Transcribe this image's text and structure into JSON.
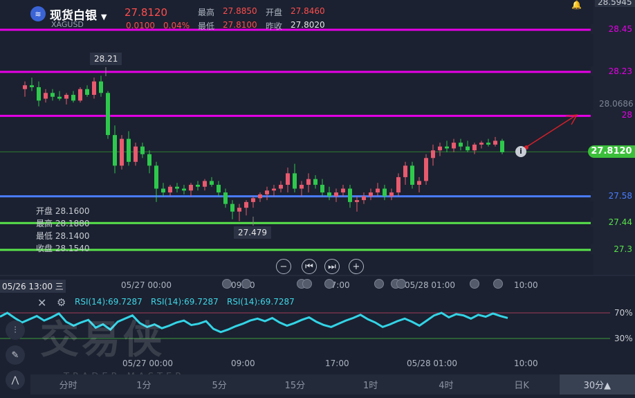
{
  "header": {
    "title": "现货白银",
    "symbol": "XAGUSD",
    "price": "27.8120",
    "change": "0.0100",
    "change_pct": "0.04%",
    "high_label": "最高",
    "high": "27.8850",
    "open_label": "开盘",
    "open": "27.8460",
    "low_label": "最低",
    "low": "27.8100",
    "prev_close_label": "昨收",
    "prev_close": "27.8020",
    "top_price": "28.5945",
    "bell_icon": "bell-icon"
  },
  "levels": [
    {
      "value": 28.45,
      "label": "28.45",
      "color": "#e600e6"
    },
    {
      "value": 28.23,
      "label": "28.23",
      "color": "#e600e6"
    },
    {
      "value": 28.0,
      "label": "28",
      "color": "#e600e6"
    },
    {
      "value": 27.58,
      "label": "27.58",
      "color": "#4a7dff"
    },
    {
      "value": 27.44,
      "label": "27.44",
      "color": "#59e34a"
    },
    {
      "value": 27.3,
      "label": "27.3",
      "color": "#59e34a"
    }
  ],
  "axis_labels": {
    "p1": "28.0686"
  },
  "current_price_tag": "27.8120",
  "annotations": {
    "high_marker": "28.21",
    "low_marker": "27.479"
  },
  "ohlc_box": {
    "open_label": "开盘",
    "open": "28.1600",
    "high_label": "最高",
    "high": "28.1880",
    "low_label": "最低",
    "low": "28.1400",
    "close_label": "收盘",
    "close": "28.1540"
  },
  "toolbar": {
    "zoom_out": "−",
    "prev": "⏮",
    "next": "⏭",
    "zoom_in": "+"
  },
  "time_axis": {
    "cursor_label": "05/26 13:00 三",
    "t1": "05/27 00:00",
    "t2": "09:00",
    "t3": "17:00",
    "t4": "05/28 01:00",
    "t5": "10:00"
  },
  "rsi": {
    "label1": "RSI(14):69.7287",
    "label2": "RSI(14):69.7287",
    "label3": "RSI(14):69.7287",
    "upper": "70%",
    "lower": "30%",
    "t1": "05/27 00:00",
    "t2": "09:00",
    "t3": "17:00",
    "t4": "05/28 01:00",
    "t5": "10:00"
  },
  "watermark": {
    "main": "交易侠",
    "sub": "TRADER MASTER"
  },
  "tabs": [
    "分时",
    "1分",
    "5分",
    "15分",
    "1时",
    "4时",
    "日K",
    "30分▲"
  ],
  "active_tab": 7,
  "chart_data": {
    "type": "candlestick",
    "ylim": [
      27.2,
      28.6
    ],
    "candles": [
      {
        "o": 28.14,
        "h": 28.18,
        "l": 28.1,
        "c": 28.16
      },
      {
        "o": 28.16,
        "h": 28.2,
        "l": 28.13,
        "c": 28.15
      },
      {
        "o": 28.15,
        "h": 28.18,
        "l": 28.05,
        "c": 28.08
      },
      {
        "o": 28.09,
        "h": 28.14,
        "l": 28.07,
        "c": 28.12
      },
      {
        "o": 28.12,
        "h": 28.14,
        "l": 28.08,
        "c": 28.1
      },
      {
        "o": 28.1,
        "h": 28.13,
        "l": 28.08,
        "c": 28.09
      },
      {
        "o": 28.09,
        "h": 28.12,
        "l": 28.06,
        "c": 28.11
      },
      {
        "o": 28.11,
        "h": 28.13,
        "l": 28.07,
        "c": 28.08
      },
      {
        "o": 28.08,
        "h": 28.15,
        "l": 28.07,
        "c": 28.14
      },
      {
        "o": 28.14,
        "h": 28.16,
        "l": 28.1,
        "c": 28.11
      },
      {
        "o": 28.11,
        "h": 28.2,
        "l": 28.09,
        "c": 28.18
      },
      {
        "o": 28.18,
        "h": 28.21,
        "l": 28.1,
        "c": 28.12
      },
      {
        "o": 28.12,
        "h": 28.13,
        "l": 27.88,
        "c": 27.9
      },
      {
        "o": 27.9,
        "h": 27.95,
        "l": 27.7,
        "c": 27.74
      },
      {
        "o": 27.74,
        "h": 27.9,
        "l": 27.72,
        "c": 27.88
      },
      {
        "o": 27.88,
        "h": 27.92,
        "l": 27.74,
        "c": 27.76
      },
      {
        "o": 27.76,
        "h": 27.86,
        "l": 27.74,
        "c": 27.84
      },
      {
        "o": 27.84,
        "h": 27.86,
        "l": 27.78,
        "c": 27.8
      },
      {
        "o": 27.8,
        "h": 27.82,
        "l": 27.7,
        "c": 27.74
      },
      {
        "o": 27.74,
        "h": 27.76,
        "l": 27.55,
        "c": 27.62
      },
      {
        "o": 27.62,
        "h": 27.65,
        "l": 27.58,
        "c": 27.6
      },
      {
        "o": 27.6,
        "h": 27.64,
        "l": 27.58,
        "c": 27.63
      },
      {
        "o": 27.63,
        "h": 27.65,
        "l": 27.6,
        "c": 27.62
      },
      {
        "o": 27.62,
        "h": 27.64,
        "l": 27.59,
        "c": 27.61
      },
      {
        "o": 27.61,
        "h": 27.65,
        "l": 27.58,
        "c": 27.64
      },
      {
        "o": 27.64,
        "h": 27.66,
        "l": 27.61,
        "c": 27.63
      },
      {
        "o": 27.63,
        "h": 27.67,
        "l": 27.61,
        "c": 27.66
      },
      {
        "o": 27.66,
        "h": 27.68,
        "l": 27.63,
        "c": 27.64
      },
      {
        "o": 27.64,
        "h": 27.66,
        "l": 27.58,
        "c": 27.6
      },
      {
        "o": 27.6,
        "h": 27.62,
        "l": 27.52,
        "c": 27.54
      },
      {
        "o": 27.54,
        "h": 27.56,
        "l": 27.46,
        "c": 27.5
      },
      {
        "o": 27.5,
        "h": 27.54,
        "l": 27.45,
        "c": 27.52
      },
      {
        "o": 27.52,
        "h": 27.56,
        "l": 27.48,
        "c": 27.55
      },
      {
        "o": 27.55,
        "h": 27.58,
        "l": 27.52,
        "c": 27.57
      },
      {
        "o": 27.57,
        "h": 27.6,
        "l": 27.55,
        "c": 27.59
      },
      {
        "o": 27.59,
        "h": 27.63,
        "l": 27.56,
        "c": 27.61
      },
      {
        "o": 27.61,
        "h": 27.64,
        "l": 27.58,
        "c": 27.62
      },
      {
        "o": 27.62,
        "h": 27.66,
        "l": 27.6,
        "c": 27.64
      },
      {
        "o": 27.64,
        "h": 27.73,
        "l": 27.6,
        "c": 27.7
      },
      {
        "o": 27.7,
        "h": 27.75,
        "l": 27.6,
        "c": 27.62
      },
      {
        "o": 27.62,
        "h": 27.66,
        "l": 27.58,
        "c": 27.64
      },
      {
        "o": 27.64,
        "h": 27.7,
        "l": 27.6,
        "c": 27.67
      },
      {
        "o": 27.67,
        "h": 27.69,
        "l": 27.62,
        "c": 27.64
      },
      {
        "o": 27.64,
        "h": 27.67,
        "l": 27.58,
        "c": 27.6
      },
      {
        "o": 27.6,
        "h": 27.63,
        "l": 27.56,
        "c": 27.58
      },
      {
        "o": 27.58,
        "h": 27.62,
        "l": 27.55,
        "c": 27.6
      },
      {
        "o": 27.6,
        "h": 27.64,
        "l": 27.58,
        "c": 27.62
      },
      {
        "o": 27.62,
        "h": 27.64,
        "l": 27.52,
        "c": 27.55
      },
      {
        "o": 27.55,
        "h": 27.58,
        "l": 27.5,
        "c": 27.56
      },
      {
        "o": 27.56,
        "h": 27.6,
        "l": 27.54,
        "c": 27.58
      },
      {
        "o": 27.58,
        "h": 27.62,
        "l": 27.56,
        "c": 27.6
      },
      {
        "o": 27.6,
        "h": 27.65,
        "l": 27.58,
        "c": 27.62
      },
      {
        "o": 27.62,
        "h": 27.64,
        "l": 27.56,
        "c": 27.58
      },
      {
        "o": 27.58,
        "h": 27.62,
        "l": 27.56,
        "c": 27.6
      },
      {
        "o": 27.6,
        "h": 27.7,
        "l": 27.58,
        "c": 27.68
      },
      {
        "o": 27.68,
        "h": 27.76,
        "l": 27.64,
        "c": 27.74
      },
      {
        "o": 27.74,
        "h": 27.76,
        "l": 27.62,
        "c": 27.64
      },
      {
        "o": 27.64,
        "h": 27.68,
        "l": 27.6,
        "c": 27.66
      },
      {
        "o": 27.66,
        "h": 27.8,
        "l": 27.64,
        "c": 27.78
      },
      {
        "o": 27.78,
        "h": 27.85,
        "l": 27.74,
        "c": 27.82
      },
      {
        "o": 27.82,
        "h": 27.86,
        "l": 27.79,
        "c": 27.84
      },
      {
        "o": 27.84,
        "h": 27.87,
        "l": 27.81,
        "c": 27.83
      },
      {
        "o": 27.83,
        "h": 27.88,
        "l": 27.81,
        "c": 27.86
      },
      {
        "o": 27.86,
        "h": 27.88,
        "l": 27.82,
        "c": 27.84
      },
      {
        "o": 27.84,
        "h": 27.87,
        "l": 27.81,
        "c": 27.82
      },
      {
        "o": 27.82,
        "h": 27.86,
        "l": 27.8,
        "c": 27.85
      },
      {
        "o": 27.85,
        "h": 27.87,
        "l": 27.83,
        "c": 27.86
      },
      {
        "o": 27.86,
        "h": 27.88,
        "l": 27.84,
        "c": 27.85
      },
      {
        "o": 27.85,
        "h": 27.89,
        "l": 27.84,
        "c": 27.87
      },
      {
        "o": 27.87,
        "h": 27.88,
        "l": 27.8,
        "c": 27.81
      }
    ],
    "rsi_values": [
      64,
      70,
      62,
      55,
      60,
      65,
      58,
      63,
      69,
      56,
      50,
      55,
      59,
      47,
      52,
      44,
      56,
      61,
      66,
      54,
      48,
      52,
      46,
      50,
      55,
      58,
      51,
      53,
      57,
      45,
      40,
      44,
      49,
      53,
      58,
      61,
      57,
      62,
      55,
      50,
      54,
      59,
      63,
      56,
      51,
      48,
      53,
      58,
      62,
      67,
      60,
      55,
      48,
      52,
      57,
      61,
      56,
      50,
      58,
      66,
      70,
      63,
      68,
      66,
      61,
      67,
      64,
      69,
      65,
      62
    ]
  }
}
